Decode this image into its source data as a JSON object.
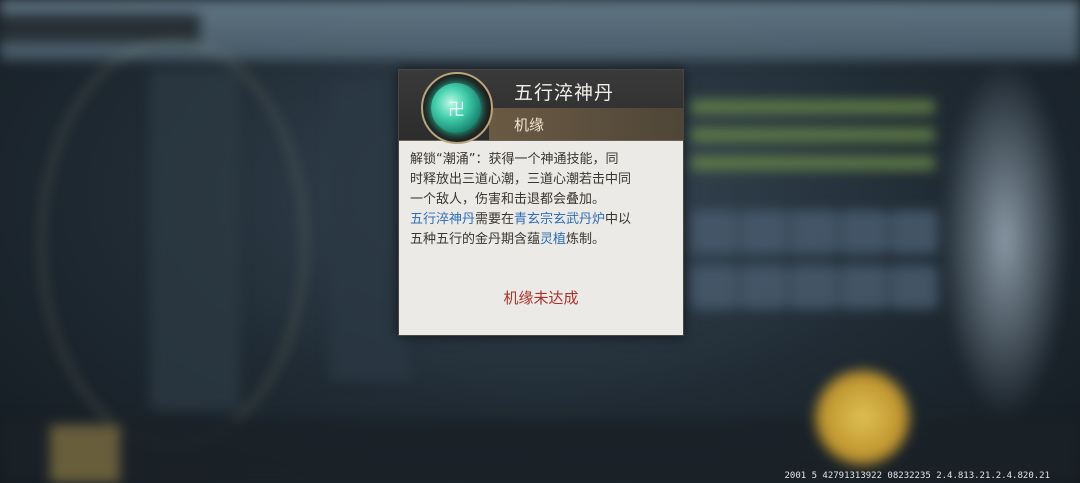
{
  "popup": {
    "title": "五行淬神丹",
    "subtitle": "机缘",
    "icon": "jade-pill-icon",
    "description": {
      "line1": "解锁“潮涌”：获得一个神通技能，同",
      "line2": "时释放出三道心潮，三道心潮若击中同",
      "line3": "一个敌人，伤害和击退都会叠加。",
      "line4_hl": "五行淬神丹",
      "line4_mid": "需要在",
      "line4_hl2": "青玄宗玄武丹炉",
      "line4_end": "中以",
      "line5_a": "五种五行的金丹期含蕴",
      "line5_hl": "灵植",
      "line5_b": "炼制。"
    },
    "status": "机缘未达成"
  },
  "footer": {
    "version_text": "2001 5 42791313922 08232235 2.4.813.21.2.4.820.21"
  },
  "colors": {
    "highlight": "#2f6db5",
    "status": "#a9322b",
    "header_bg": "#2c2c2c"
  }
}
